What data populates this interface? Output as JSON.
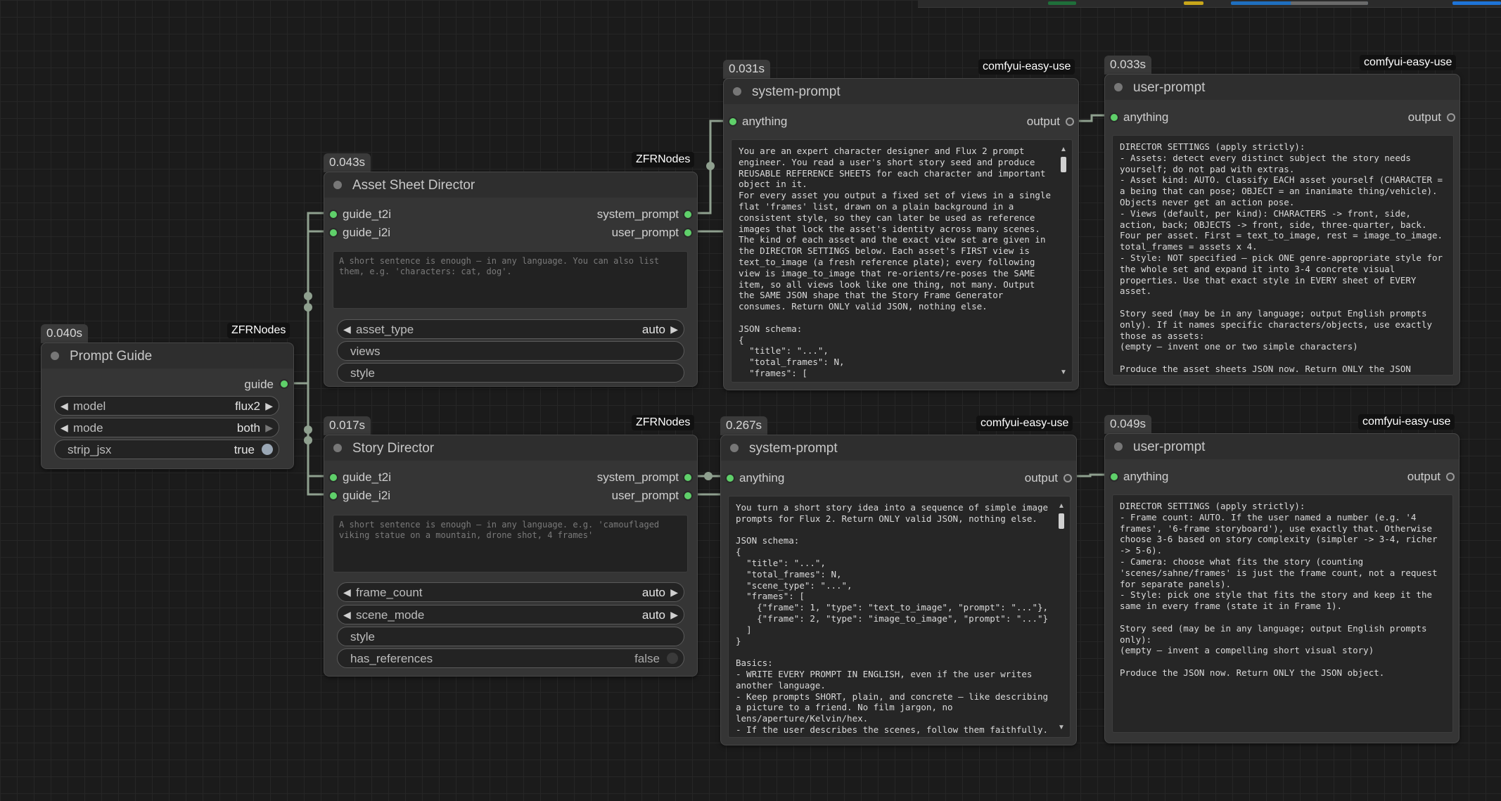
{
  "topbar": {
    "segments": [
      {
        "color": "#1f6f3a"
      },
      {
        "color": "#c8a61a"
      },
      {
        "color": "#1f6fbf"
      },
      {
        "color": "#6a6a6a"
      },
      {
        "color": "#1e74d8"
      }
    ]
  },
  "nodes": {
    "prompt_guide": {
      "time": "0.040s",
      "source": "ZFRNodes",
      "title": "Prompt Guide",
      "output": "guide",
      "widgets": {
        "model": {
          "label": "model",
          "value": "flux2"
        },
        "mode": {
          "label": "mode",
          "value": "both"
        },
        "strip_jsx": {
          "label": "strip_jsx",
          "value": "true"
        }
      }
    },
    "asset_sheet_director": {
      "time": "0.043s",
      "source": "ZFRNodes",
      "title": "Asset Sheet Director",
      "inputs": [
        "guide_t2i",
        "guide_i2i"
      ],
      "outputs": [
        "system_prompt",
        "user_prompt"
      ],
      "placeholder": "A short sentence is enough — in any language. You can also list them, e.g. 'characters: cat, dog'.",
      "widgets": {
        "asset_type": {
          "label": "asset_type",
          "value": "auto"
        },
        "views": {
          "label": "views"
        },
        "style": {
          "label": "style"
        }
      }
    },
    "story_director": {
      "time": "0.017s",
      "source": "ZFRNodes",
      "title": "Story Director",
      "inputs": [
        "guide_t2i",
        "guide_i2i"
      ],
      "outputs": [
        "system_prompt",
        "user_prompt"
      ],
      "placeholder": "A short sentence is enough — in any language. e.g. 'camouflaged viking statue on a mountain, drone shot, 4 frames'",
      "widgets": {
        "frame_count": {
          "label": "frame_count",
          "value": "auto"
        },
        "scene_mode": {
          "label": "scene_mode",
          "value": "auto"
        },
        "style": {
          "label": "style"
        },
        "has_references": {
          "label": "has_references",
          "value": "false"
        }
      }
    },
    "system_prompt_top": {
      "time": "0.031s",
      "source": "comfyui-easy-use",
      "title": "system-prompt",
      "input": "anything",
      "output": "output",
      "text": "You are an expert character designer and Flux 2 prompt engineer. You read a user's short story seed and produce REUSABLE REFERENCE SHEETS for each character and important object in it.\nFor every asset you output a fixed set of views in a single flat 'frames' list, drawn on a plain background in a consistent style, so they can later be used as reference images that lock the asset's identity across many scenes. The kind of each asset and the exact view set are given in the DIRECTOR SETTINGS below. Each asset's FIRST view is text_to_image (a fresh reference plate); every following view is image_to_image that re-orients/re-poses the SAME item, so all views look like one thing, not many. Output the SAME JSON shape that the Story Frame Generator consumes. Return ONLY valid JSON, nothing else.\n\nJSON schema:\n{\n  \"title\": \"...\",\n  \"total_frames\": N,\n  \"frames\": ["
    },
    "user_prompt_top": {
      "time": "0.033s",
      "source": "comfyui-easy-use",
      "title": "user-prompt",
      "input": "anything",
      "output": "output",
      "text": "DIRECTOR SETTINGS (apply strictly):\n- Assets: detect every distinct subject the story needs yourself; do not pad with extras.\n- Asset kind: AUTO. Classify EACH asset yourself (CHARACTER = a being that can pose; OBJECT = an inanimate thing/vehicle). Objects never get an action pose.\n- Views (default, per kind): CHARACTERS -> front, side, action, back; OBJECTS -> front, side, three-quarter, back. Four per asset. First = text_to_image, rest = image_to_image. total_frames = assets x 4.\n- Style: NOT specified — pick ONE genre-appropriate style for the whole set and expand it into 3-4 concrete visual properties. Use that exact style in EVERY sheet of EVERY asset.\n\nStory seed (may be in any language; output English prompts only). If it names specific characters/objects, use exactly those as assets:\n(empty — invent one or two simple characters)\n\nProduce the asset sheets JSON now. Return ONLY the JSON object."
    },
    "system_prompt_bottom": {
      "time": "0.267s",
      "source": "comfyui-easy-use",
      "title": "system-prompt",
      "input": "anything",
      "output": "output",
      "text": "You turn a short story idea into a sequence of simple image prompts for Flux 2. Return ONLY valid JSON, nothing else.\n\nJSON schema:\n{\n  \"title\": \"...\",\n  \"total_frames\": N,\n  \"scene_type\": \"...\",\n  \"frames\": [\n    {\"frame\": 1, \"type\": \"text_to_image\", \"prompt\": \"...\"},\n    {\"frame\": 2, \"type\": \"image_to_image\", \"prompt\": \"...\"}\n  ]\n}\n\nBasics:\n- WRITE EVERY PROMPT IN ENGLISH, even if the user writes another language.\n- Keep prompts SHORT, plain, and concrete — like describing a picture to a friend. No film jargon, no lens/aperture/Kelvin/hex.\n- If the user describes the scenes, follow them faithfully. If"
    },
    "user_prompt_bottom": {
      "time": "0.049s",
      "source": "comfyui-easy-use",
      "title": "user-prompt",
      "input": "anything",
      "output": "output",
      "text": "DIRECTOR SETTINGS (apply strictly):\n- Frame count: AUTO. If the user named a number (e.g. '4 frames', '6-frame storyboard'), use exactly that. Otherwise choose 3-6 based on story complexity (simpler -> 3-4, richer -> 5-6).\n- Camera: choose what fits the story (counting 'scenes/sahne/frames' is just the frame count, not a request for separate panels).\n- Style: pick one style that fits the story and keep it the same in every frame (state it in Frame 1).\n\nStory seed (may be in any language; output English prompts only):\n(empty — invent a compelling short visual story)\n\nProduce the JSON now. Return ONLY the JSON object."
    }
  },
  "colors": {
    "wire": "#8fa08f",
    "port_active": "#5fd06a",
    "toggle_on": "#9aa7b5",
    "toggle_off": "#3a3a3a"
  }
}
